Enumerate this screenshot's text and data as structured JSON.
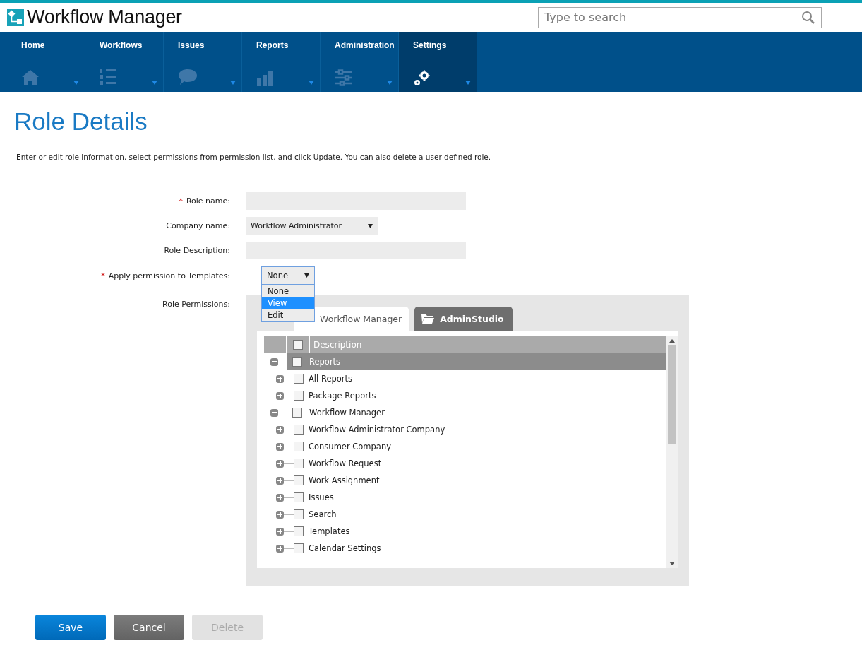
{
  "header": {
    "logo_text": "Workflow Manager",
    "search": {
      "placeholder": "Type to search"
    }
  },
  "nav": [
    {
      "label": "Home",
      "selected": false
    },
    {
      "label": "Workflows",
      "selected": false
    },
    {
      "label": "Issues",
      "selected": false
    },
    {
      "label": "Reports",
      "selected": false
    },
    {
      "label": "Administration",
      "selected": false
    },
    {
      "label": "Settings",
      "selected": true
    }
  ],
  "page": {
    "title": "Role Details",
    "intro": "Enter or edit role information, select permissions from permission list, and click Update. You can also delete a user defined role."
  },
  "form": {
    "role_name": {
      "label": "Role name:",
      "required_mark": "*"
    },
    "company": {
      "label": "Company name:",
      "value": "Workflow Administrator"
    },
    "description": {
      "label": "Role Description:"
    },
    "apply_templates": {
      "label": "Apply permission to Templates:",
      "required_mark": "*",
      "value": "None",
      "expanded": true,
      "options": [
        {
          "label": "None",
          "highlighted": false
        },
        {
          "label": "View",
          "highlighted": true
        },
        {
          "label": "Edit",
          "highlighted": false
        }
      ]
    },
    "permissions_label": "Role Permissions:"
  },
  "permission_tabs": [
    {
      "label": "Workflow Manager",
      "selected": true
    },
    {
      "label": "AdminStudio",
      "selected": false
    }
  ],
  "tree": {
    "header": {
      "label": "Description",
      "checked": false
    },
    "rows": [
      {
        "label": "Reports",
        "checked": false,
        "expanded": true,
        "selected": true,
        "children": [
          {
            "label": "All Reports",
            "checked": false,
            "expanded": false,
            "selected": false
          },
          {
            "label": "Package Reports",
            "checked": false,
            "expanded": false,
            "selected": false
          }
        ]
      },
      {
        "label": "Workflow Manager",
        "checked": false,
        "expanded": true,
        "selected": false,
        "children": [
          {
            "label": "Workflow Administrator Company",
            "checked": false,
            "expanded": false,
            "selected": false
          },
          {
            "label": "Consumer Company",
            "checked": false,
            "expanded": false,
            "selected": false
          },
          {
            "label": "Workflow Request",
            "checked": false,
            "expanded": false,
            "selected": false
          },
          {
            "label": "Work Assignment",
            "checked": false,
            "expanded": false,
            "selected": false
          },
          {
            "label": "Issues",
            "checked": false,
            "expanded": false,
            "selected": false
          },
          {
            "label": "Search",
            "checked": false,
            "expanded": false,
            "selected": false
          },
          {
            "label": "Templates",
            "checked": false,
            "expanded": false,
            "selected": false
          },
          {
            "label": "Calendar Settings",
            "checked": false,
            "expanded": false,
            "selected": false
          }
        ]
      }
    ]
  },
  "buttons": [
    {
      "label": "Save",
      "kind": "primary",
      "disabled": false
    },
    {
      "label": "Cancel",
      "kind": "secondary",
      "disabled": false
    },
    {
      "label": "Delete",
      "kind": "danger",
      "disabled": true
    }
  ]
}
